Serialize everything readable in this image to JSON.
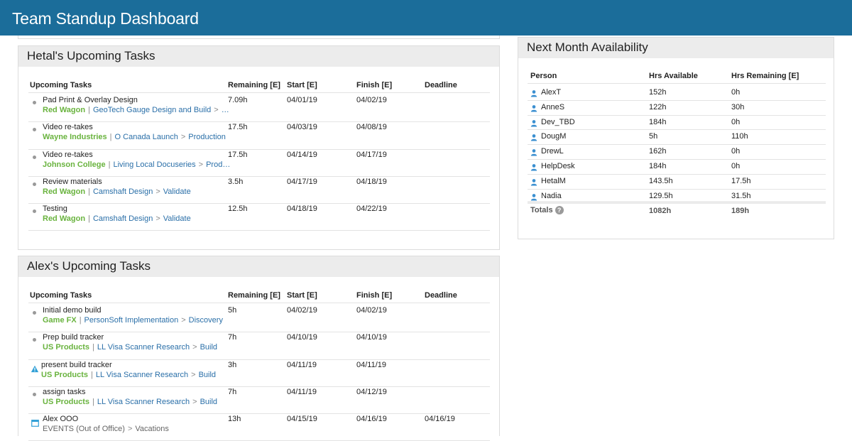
{
  "app": {
    "title": "Team Standup Dashboard"
  },
  "hetal": {
    "title": "Hetal's Upcoming Tasks",
    "headers": {
      "task": "Upcoming Tasks",
      "remaining": "Remaining [E]",
      "start": "Start [E]",
      "finish": "Finish [E]",
      "deadline": "Deadline"
    },
    "rows": [
      {
        "name": "Pad Print & Overlay Design",
        "client": "Red Wagon",
        "path": [
          "GeoTech Gauge Design and Build",
          "…"
        ],
        "remaining": "7.09h",
        "start": "04/01/19",
        "finish": "04/02/19",
        "deadline": ""
      },
      {
        "name": "Video re-takes",
        "client": "Wayne Industries",
        "path": [
          "O Canada Launch",
          "Production"
        ],
        "remaining": "17.5h",
        "start": "04/03/19",
        "finish": "04/08/19",
        "deadline": ""
      },
      {
        "name": "Video re-takes",
        "client": "Johnson College",
        "path": [
          "Living Local Docuseries",
          "Prod…"
        ],
        "remaining": "17.5h",
        "start": "04/14/19",
        "finish": "04/17/19",
        "deadline": ""
      },
      {
        "name": "Review materials",
        "client": "Red Wagon",
        "path": [
          "Camshaft Design",
          "Validate"
        ],
        "remaining": "3.5h",
        "start": "04/17/19",
        "finish": "04/18/19",
        "deadline": ""
      },
      {
        "name": "Testing",
        "client": "Red Wagon",
        "path": [
          "Camshaft Design",
          "Validate"
        ],
        "remaining": "12.5h",
        "start": "04/18/19",
        "finish": "04/22/19",
        "deadline": ""
      }
    ]
  },
  "alex": {
    "title": "Alex's Upcoming Tasks",
    "headers": {
      "task": "Upcoming Tasks",
      "remaining": "Remaining [E]",
      "start": "Start [E]",
      "finish": "Finish [E]",
      "deadline": "Deadline"
    },
    "rows": [
      {
        "icon": "dot",
        "name": "Initial demo build",
        "client": "Game FX",
        "path": [
          "PersonSoft Implementation",
          "Discovery"
        ],
        "remaining": "5h",
        "start": "04/02/19",
        "finish": "04/02/19",
        "deadline": ""
      },
      {
        "icon": "dot",
        "name": "Prep build tracker",
        "client": "US Products",
        "path": [
          "LL Visa Scanner Research",
          "Build"
        ],
        "remaining": "7h",
        "start": "04/10/19",
        "finish": "04/10/19",
        "deadline": ""
      },
      {
        "icon": "warning-icon",
        "name": "present build tracker",
        "client": "US Products",
        "path": [
          "LL Visa Scanner Research",
          "Build"
        ],
        "remaining": "3h",
        "start": "04/11/19",
        "finish": "04/11/19",
        "deadline": ""
      },
      {
        "icon": "dot",
        "name": "assign tasks",
        "client": "US Products",
        "path": [
          "LL Visa Scanner Research",
          "Build"
        ],
        "remaining": "7h",
        "start": "04/11/19",
        "finish": "04/12/19",
        "deadline": ""
      },
      {
        "icon": "calendar-icon",
        "name": "Alex OOO",
        "client": "EVENTS (Out of Office)",
        "path": [
          "Vacations"
        ],
        "remaining": "13h",
        "start": "04/15/19",
        "finish": "04/16/19",
        "deadline": "04/16/19"
      }
    ]
  },
  "availability": {
    "title": "Next Month Availability",
    "headers": {
      "person": "Person",
      "available": "Hrs Available",
      "remaining": "Hrs Remaining [E]"
    },
    "rows": [
      {
        "person": "AlexT",
        "available": "152h",
        "remaining": "0h"
      },
      {
        "person": "AnneS",
        "available": "122h",
        "remaining": "30h"
      },
      {
        "person": "Dev_TBD",
        "available": "184h",
        "remaining": "0h"
      },
      {
        "person": "DougM",
        "available": "5h",
        "remaining": "110h"
      },
      {
        "person": "DrewL",
        "available": "162h",
        "remaining": "0h"
      },
      {
        "person": "HelpDesk",
        "available": "184h",
        "remaining": "0h"
      },
      {
        "person": "HetalM",
        "available": "143.5h",
        "remaining": "17.5h"
      },
      {
        "person": "Nadia",
        "available": "129.5h",
        "remaining": "31.5h"
      }
    ],
    "totals": {
      "label": "Totals",
      "available": "1082h",
      "remaining": "189h"
    }
  },
  "colors": {
    "header_bar": "#1b6d9a",
    "client_green": "#69b33e",
    "link_blue": "#2a6fa8",
    "person_icon": "#3a8fd0",
    "warning": "#2f9fd6"
  }
}
